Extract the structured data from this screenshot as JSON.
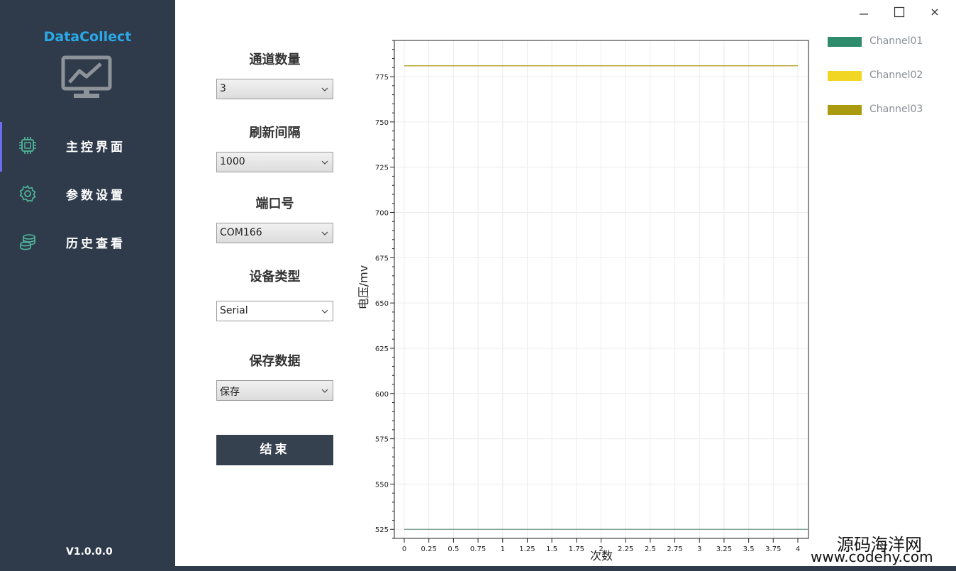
{
  "sidebar": {
    "app_title": "DataCollect",
    "logo_icon": "monitor-chart-icon",
    "items": [
      {
        "label": "主控界面",
        "icon": "chip-icon",
        "active": true
      },
      {
        "label": "参数设置",
        "icon": "gear-icon",
        "active": false
      },
      {
        "label": "历史查看",
        "icon": "database-icon",
        "active": false
      }
    ],
    "version": "V1.0.0.0"
  },
  "window_controls": {
    "minimize": "—",
    "maximize": "☐",
    "close": "×"
  },
  "controls": {
    "channel_count": {
      "label": "通道数量",
      "value": "3"
    },
    "refresh_interval": {
      "label": "刷新间隔",
      "value": "1000"
    },
    "port": {
      "label": "端口号",
      "value": "COM166"
    },
    "device_type": {
      "label": "设备类型",
      "value": "Serial"
    },
    "save_data": {
      "label": "保存数据",
      "value": "保存"
    },
    "stop_label": "结束"
  },
  "legend": [
    {
      "label": "Channel01",
      "color": "#2e8b6b"
    },
    {
      "label": "Channel02",
      "color": "#f2d624"
    },
    {
      "label": "Channel03",
      "color": "#a99a10"
    }
  ],
  "chart_data": {
    "type": "line",
    "xlabel": "次数",
    "ylabel": "电压/mv",
    "xlim": [
      0,
      4
    ],
    "ylim": [
      520,
      795
    ],
    "xticks": [
      "0",
      "0.25",
      "0.5",
      "0.75",
      "1",
      "1.25",
      "1.5",
      "1.75",
      "2",
      "2.25",
      "2.5",
      "2.75",
      "3",
      "3.25",
      "3.5",
      "3.75",
      "4"
    ],
    "yticks": [
      "525",
      "550",
      "575",
      "600",
      "625",
      "650",
      "675",
      "700",
      "725",
      "750",
      "775"
    ],
    "grid": true,
    "series": [
      {
        "name": "Channel01",
        "color": "#6f9a86",
        "x": [
          0,
          4.1
        ],
        "y": [
          525,
          525
        ]
      },
      {
        "name": "Channel03",
        "color": "#a99a10",
        "x": [
          0,
          4
        ],
        "y": [
          781,
          781
        ]
      }
    ]
  },
  "watermark": {
    "cn": "源码海洋网",
    "url": "www.codehy.com"
  }
}
